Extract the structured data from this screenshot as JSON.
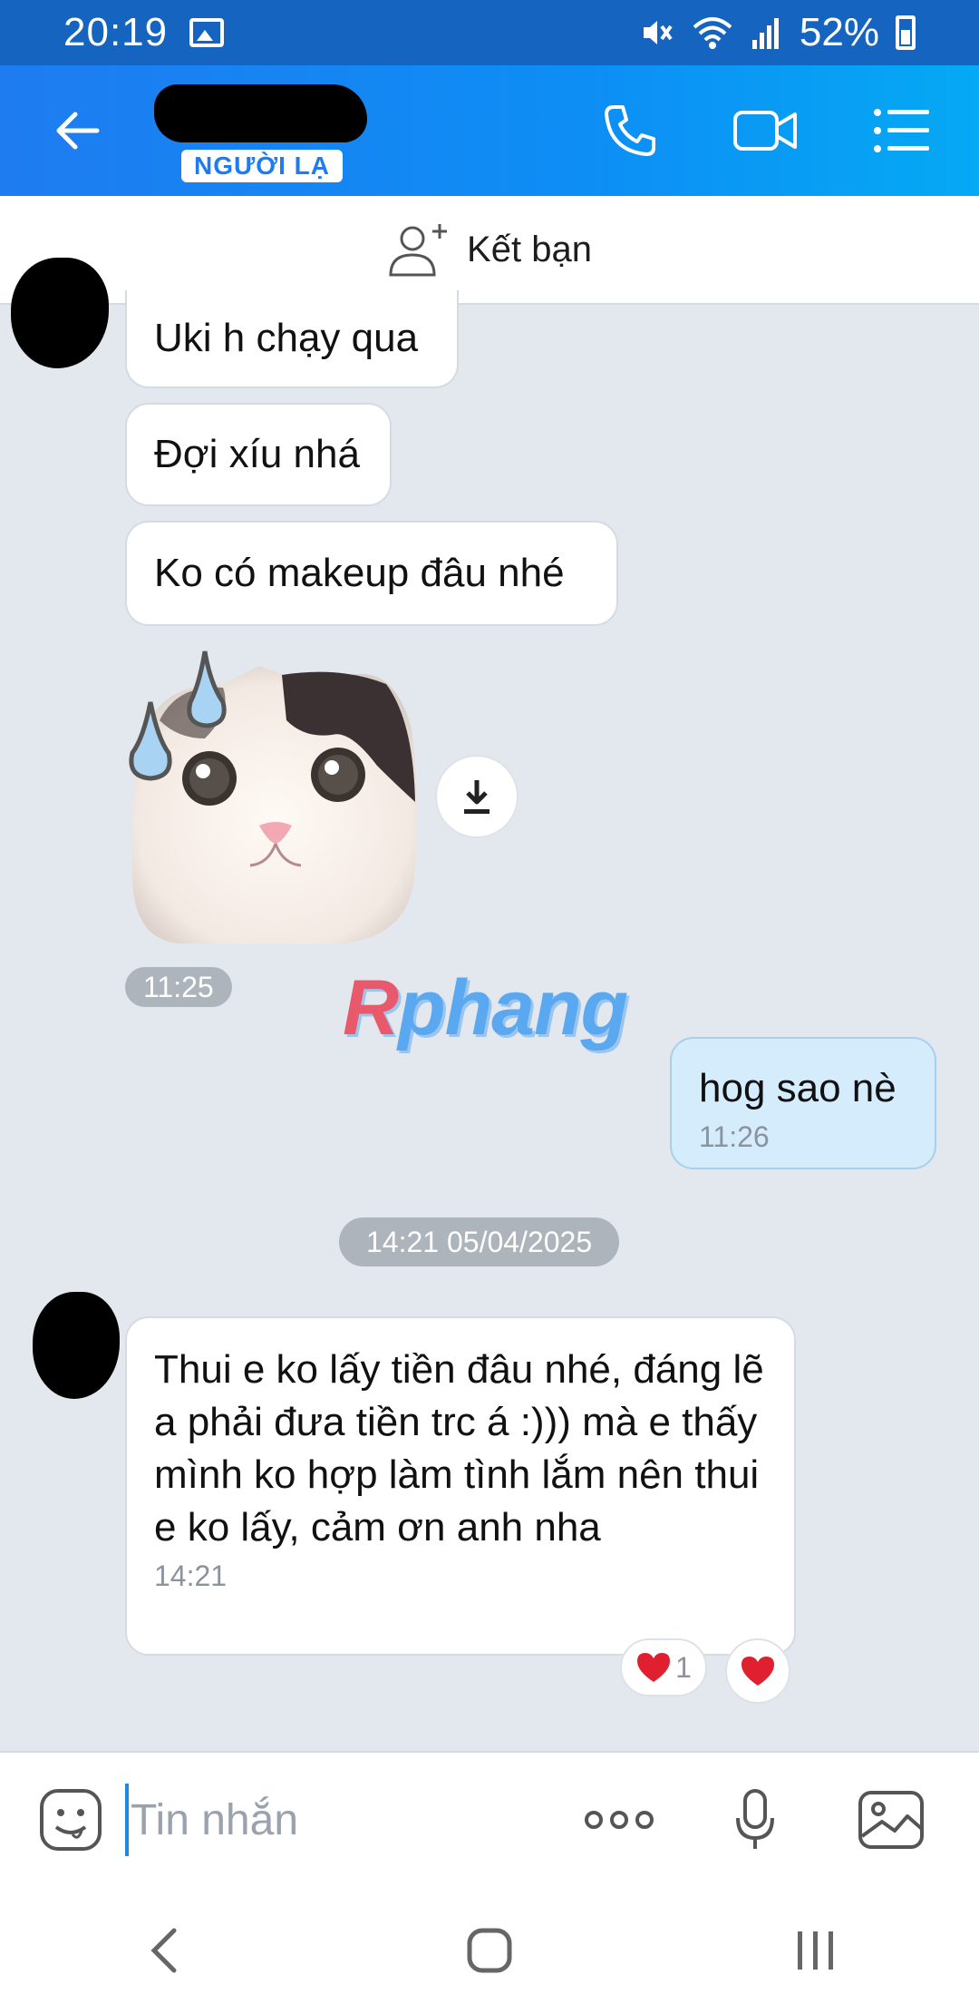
{
  "status_bar": {
    "time": "20:19",
    "battery": "52%"
  },
  "header": {
    "contact_badge": "NGƯỜI LẠ"
  },
  "add_friend": {
    "label": "Kết bạn"
  },
  "messages": {
    "received_1": "Uki h chạy qua",
    "received_2": "Đợi xíu nhá",
    "received_3": "Ko có makeup đâu nhé",
    "sticker_time": "11:25",
    "sent_1": "hog sao nè",
    "sent_1_time": "11:26",
    "date_separator": "14:21 05/04/2025",
    "received_4": "Thui e ko lấy tiền đâu nhé, đáng lẽ a phải đưa tiền trc á :))) mà e thấy mình ko hợp làm tình lắm nên thui e ko lấy, cảm ơn anh nha",
    "received_4_time": "14:21",
    "reaction_count": "1"
  },
  "watermark": {
    "first": "R",
    "rest": "phang"
  },
  "input": {
    "placeholder": "Tin nhắn"
  },
  "colors": {
    "header_start": "#1e7cf0",
    "header_end": "#05a9f4",
    "chat_background": "#e3e8ef",
    "sent_bubble": "#d5ecfd",
    "reaction_heart": "#e0202f"
  },
  "icons": {
    "status_gallery": "gallery-icon",
    "status_mute": "mute-icon",
    "status_wifi": "wifi-icon",
    "status_signal": "signal-icon",
    "back": "back-arrow-icon",
    "call": "phone-icon",
    "video": "video-camera-icon",
    "menu": "list-menu-icon",
    "add_friend": "add-user-icon",
    "download": "download-icon",
    "emoji": "emoji-icon",
    "more": "more-dots-icon",
    "mic": "microphone-icon",
    "image": "image-icon"
  }
}
